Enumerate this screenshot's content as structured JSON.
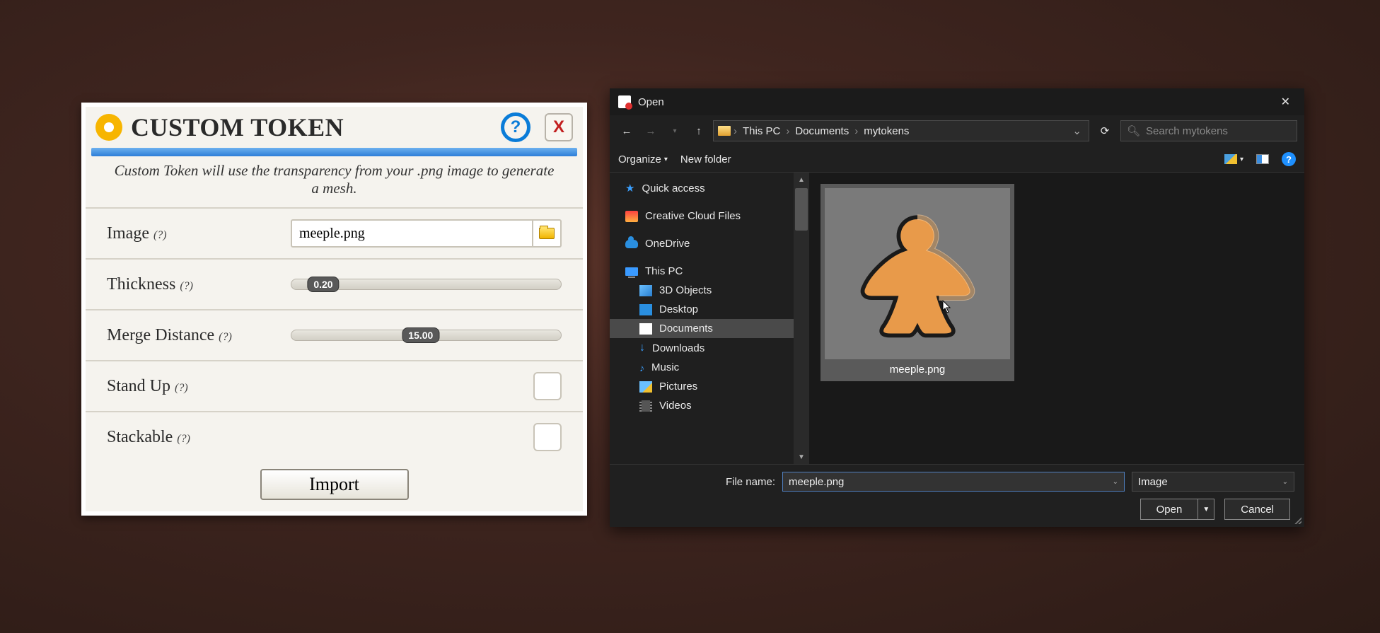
{
  "tts": {
    "title": "CUSTOM TOKEN",
    "close": "X",
    "help": "?",
    "description": "Custom Token will use the transparency from your .png image to generate a mesh.",
    "image_label": "Image",
    "image_value": "meeple.png",
    "thickness_label": "Thickness",
    "thickness_value": "0.20",
    "merge_label": "Merge Distance",
    "merge_value": "15.00",
    "standup_label": "Stand Up",
    "stackable_label": "Stackable",
    "hint": "(?)",
    "import": "Import"
  },
  "win": {
    "title": "Open",
    "crumbs": [
      "This PC",
      "Documents",
      "mytokens"
    ],
    "search_placeholder": "Search mytokens",
    "organize": "Organize",
    "newfolder": "New folder",
    "tree": [
      {
        "label": "Quick access",
        "icon": "star",
        "indent": false
      },
      {
        "label": "Creative Cloud Files",
        "icon": "cc",
        "indent": false
      },
      {
        "label": "OneDrive",
        "icon": "cloud",
        "indent": false
      },
      {
        "label": "This PC",
        "icon": "pc",
        "indent": false
      },
      {
        "label": "3D Objects",
        "icon": "3d",
        "indent": true
      },
      {
        "label": "Desktop",
        "icon": "desktop",
        "indent": true
      },
      {
        "label": "Documents",
        "icon": "doc",
        "indent": true,
        "selected": true
      },
      {
        "label": "Downloads",
        "icon": "down",
        "indent": true
      },
      {
        "label": "Music",
        "icon": "music",
        "indent": true
      },
      {
        "label": "Pictures",
        "icon": "pic",
        "indent": true
      },
      {
        "label": "Videos",
        "icon": "vid",
        "indent": true
      }
    ],
    "file": {
      "name": "meeple.png"
    },
    "filename_label": "File name:",
    "filename_value": "meeple.png",
    "filetype": "Image",
    "open": "Open",
    "cancel": "Cancel"
  }
}
